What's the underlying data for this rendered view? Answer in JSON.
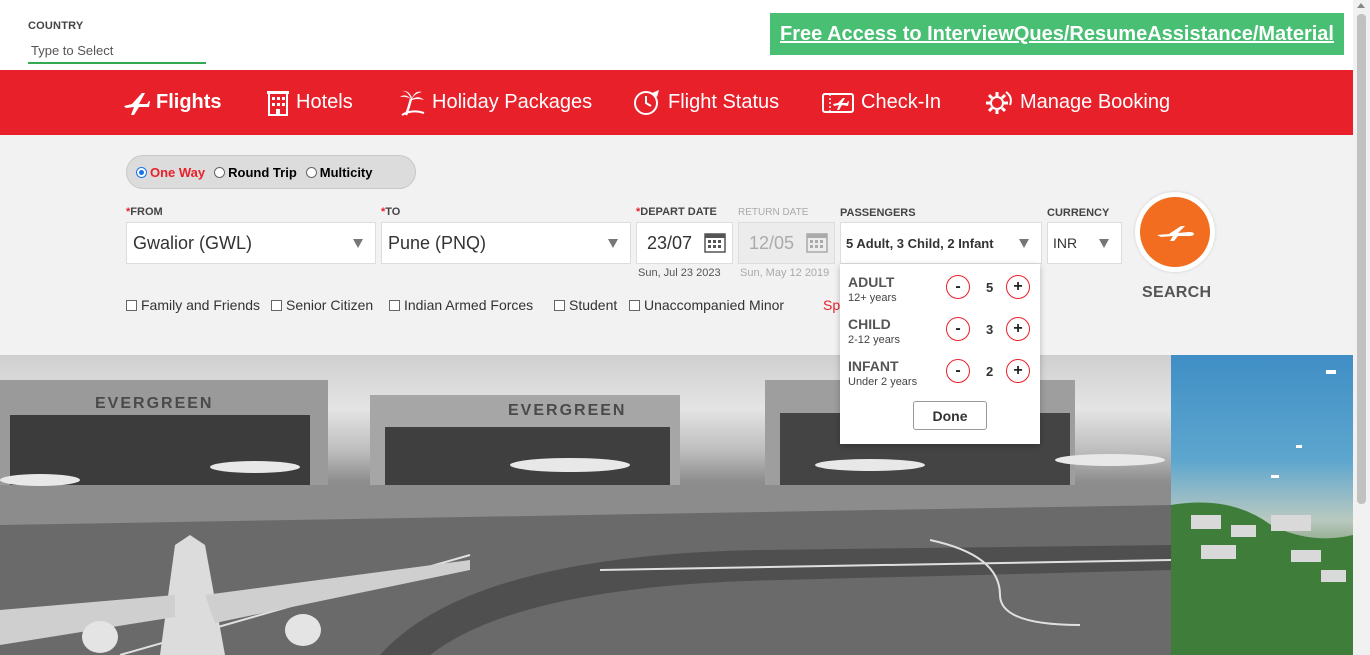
{
  "country": {
    "label": "COUNTRY",
    "placeholder": "Type to Select"
  },
  "promo": {
    "text": "Free Access to InterviewQues/ResumeAssistance/Material"
  },
  "nav": {
    "items": [
      {
        "label": "Flights",
        "icon": "plane-icon",
        "active": true
      },
      {
        "label": "Hotels",
        "icon": "hotel-icon"
      },
      {
        "label": "Holiday Packages",
        "icon": "palm-tree-icon"
      },
      {
        "label": "Flight Status",
        "icon": "clock-plane-icon"
      },
      {
        "label": "Check-In",
        "icon": "ticket-icon"
      },
      {
        "label": "Manage Booking",
        "icon": "gear-icon"
      }
    ]
  },
  "trip_type": {
    "options": [
      "One Way",
      "Round Trip",
      "Multicity"
    ],
    "selected": "One Way"
  },
  "form": {
    "from": {
      "label": "FROM",
      "value": "Gwalior (GWL)"
    },
    "to": {
      "label": "TO",
      "value": "Pune (PNQ)"
    },
    "depart": {
      "label": "DEPART DATE",
      "value": "23/07",
      "sub": "Sun, Jul 23 2023"
    },
    "return": {
      "label": "RETURN DATE",
      "value": "12/05",
      "sub": "Sun, May 12 2019"
    },
    "passengers": {
      "label": "PASSENGERS",
      "value": "5 Adult, 3 Child, 2 Infant"
    },
    "currency": {
      "label": "CURRENCY",
      "value": "INR"
    }
  },
  "checkboxes": [
    "Family and Friends",
    "Senior Citizen",
    "Indian Armed Forces",
    "Student",
    "Unaccompanied Minor"
  ],
  "special_fragment": "Sp",
  "search": {
    "label": "SEARCH"
  },
  "pax_popup": {
    "rows": [
      {
        "name": "ADULT",
        "age": "12+ years",
        "count": "5"
      },
      {
        "name": "CHILD",
        "age": "2-12 years",
        "count": "3"
      },
      {
        "name": "INFANT",
        "age": "Under 2 years",
        "count": "2"
      }
    ],
    "minus": "-",
    "plus": "+",
    "done": "Done"
  },
  "hero": {
    "hangar_sign_1": "EVERGREEN",
    "hangar_sign_2": "EVERGREEN"
  },
  "colors": {
    "brand_red": "#e8202a",
    "promo_green": "#48bf73",
    "search_orange": "#f26d1f"
  }
}
